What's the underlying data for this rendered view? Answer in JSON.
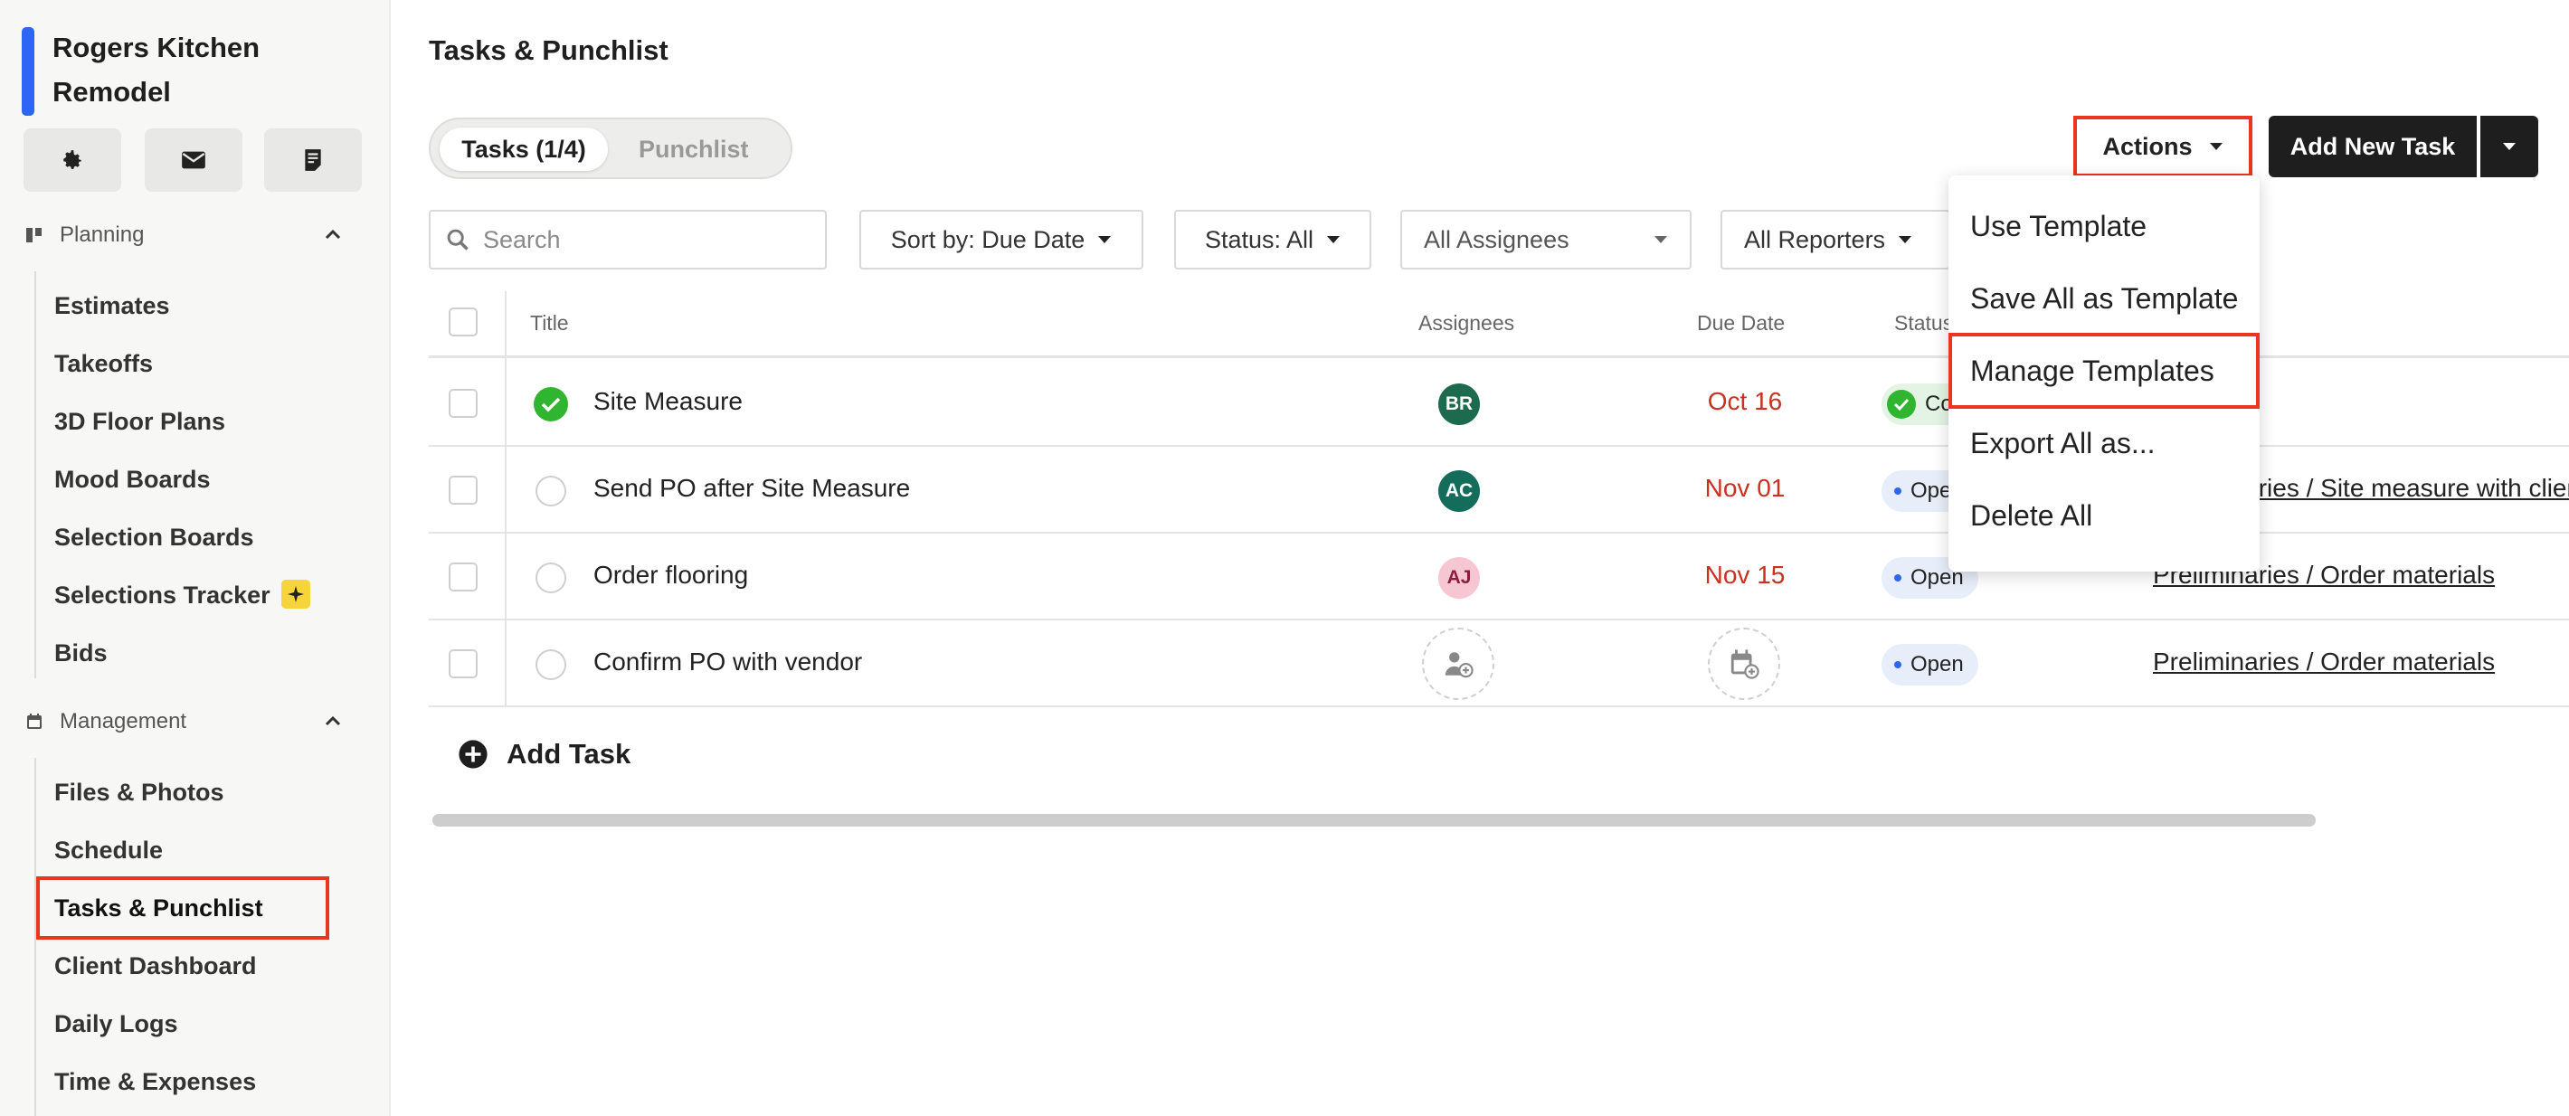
{
  "project": {
    "title": "Rogers Kitchen Remodel"
  },
  "sidebar": {
    "buttons": [
      {
        "icon": "gear-icon"
      },
      {
        "icon": "mail-icon"
      },
      {
        "icon": "notes-icon"
      }
    ],
    "sections": [
      {
        "label": "Planning",
        "icon": "planning-icon",
        "items": [
          {
            "label": "Estimates"
          },
          {
            "label": "Takeoffs"
          },
          {
            "label": "3D Floor Plans"
          },
          {
            "label": "Mood Boards"
          },
          {
            "label": "Selection Boards"
          },
          {
            "label": "Selections Tracker",
            "badge": "sparkle-icon"
          },
          {
            "label": "Bids"
          }
        ]
      },
      {
        "label": "Management",
        "icon": "calendar-icon",
        "items": [
          {
            "label": "Files & Photos"
          },
          {
            "label": "Schedule"
          },
          {
            "label": "Tasks & Punchlist",
            "active": true
          },
          {
            "label": "Client Dashboard"
          },
          {
            "label": "Daily Logs"
          },
          {
            "label": "Time & Expenses"
          }
        ]
      }
    ]
  },
  "main": {
    "title": "Tasks & Punchlist",
    "tabs": [
      {
        "label": "Tasks (1/4)",
        "active": true
      },
      {
        "label": "Punchlist"
      }
    ],
    "actions_label": "Actions",
    "add_new_label": "Add New Task",
    "filters": {
      "search_placeholder": "Search",
      "sort": "Sort by: Due Date",
      "status": "Status: All",
      "assignees": "All Assignees",
      "reporters": "All Reporters"
    },
    "columns": {
      "title": "Title",
      "assignees": "Assignees",
      "due_date": "Due Date",
      "status": "Status"
    },
    "rows": [
      {
        "title": "Site Measure",
        "done": true,
        "assignee": "BR",
        "due": "Oct 16",
        "status": "Completed",
        "link": ""
      },
      {
        "title": "Send PO after Site Measure",
        "done": false,
        "assignee": "AC",
        "due": "Nov 01",
        "status": "Open",
        "link": "Preliminaries / Site measure with client"
      },
      {
        "title": "Order flooring",
        "done": false,
        "assignee": "AJ",
        "due": "Nov 15",
        "status": "Open",
        "link": "Preliminaries / Order materials"
      },
      {
        "title": "Confirm PO with vendor",
        "done": false,
        "assignee": "",
        "due": "",
        "status": "Open",
        "link": "Preliminaries / Order materials"
      }
    ],
    "add_task_label": "Add Task"
  },
  "actions_menu": {
    "items": [
      {
        "label": "Use Template"
      },
      {
        "label": "Save All as Template"
      },
      {
        "label": "Manage Templates",
        "highlighted": true
      },
      {
        "label": "Export All as..."
      },
      {
        "label": "Delete All"
      }
    ]
  },
  "colors": {
    "accent": "#2d66f5",
    "highlight": "#e8361f",
    "danger_text": "#c8321e",
    "success": "#2fb52f",
    "dark_button": "#1e1e1e"
  },
  "avatars": {
    "BR": {
      "bg": "#1d6b4f",
      "fg": "#ffffff"
    },
    "AC": {
      "bg": "#136d5a",
      "fg": "#ffffff"
    },
    "AJ": {
      "bg": "#f7c6d3",
      "fg": "#8a1f3d"
    }
  }
}
